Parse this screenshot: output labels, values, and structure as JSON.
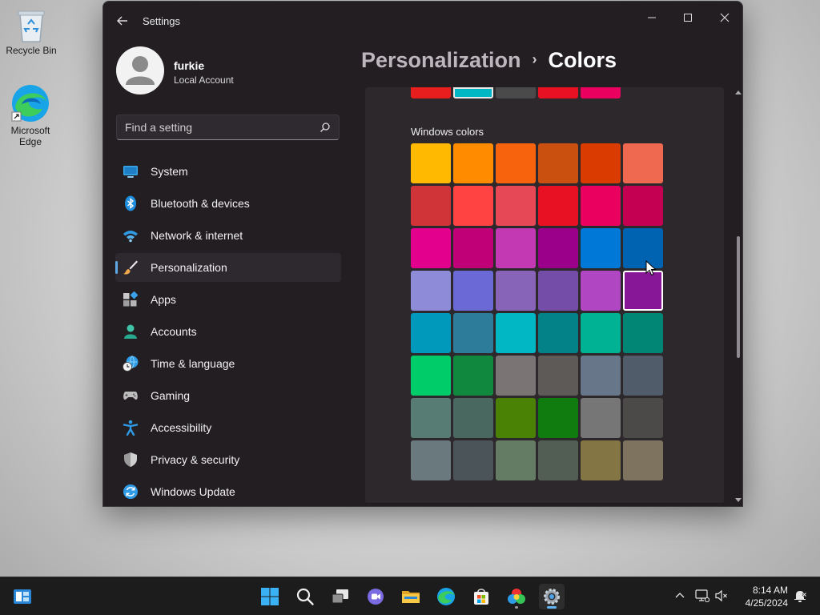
{
  "desktop": {
    "icons": [
      {
        "label": "Recycle Bin"
      },
      {
        "label": "Microsoft Edge"
      }
    ]
  },
  "window": {
    "title": "Settings",
    "user": {
      "name": "furkie",
      "account_type": "Local Account"
    },
    "search": {
      "placeholder": "Find a setting"
    },
    "nav": [
      {
        "label": "System",
        "icon": "monitor-icon"
      },
      {
        "label": "Bluetooth & devices",
        "icon": "bluetooth-icon"
      },
      {
        "label": "Network & internet",
        "icon": "wifi-icon"
      },
      {
        "label": "Personalization",
        "icon": "brush-icon",
        "active": true
      },
      {
        "label": "Apps",
        "icon": "apps-icon"
      },
      {
        "label": "Accounts",
        "icon": "person-icon"
      },
      {
        "label": "Time & language",
        "icon": "clock-globe-icon"
      },
      {
        "label": "Gaming",
        "icon": "gamepad-icon"
      },
      {
        "label": "Accessibility",
        "icon": "accessibility-icon"
      },
      {
        "label": "Privacy & security",
        "icon": "shield-icon"
      },
      {
        "label": "Windows Update",
        "icon": "update-icon"
      }
    ],
    "breadcrumb": {
      "parent": "Personalization",
      "current": "Colors"
    },
    "recent_colors": [
      "#e81e1e",
      "#00b7c3",
      "#4a4a4a",
      "#e81123",
      "#ea005e"
    ],
    "windows_colors": {
      "title": "Windows colors",
      "selected": "#881798",
      "colors": [
        "#ffb900",
        "#ff8c00",
        "#f7630c",
        "#ca5010",
        "#da3b01",
        "#ef6950",
        "#d13438",
        "#ff4343",
        "#e74856",
        "#e81123",
        "#ea005e",
        "#c30052",
        "#e3008c",
        "#bf0077",
        "#c239b3",
        "#9a0089",
        "#0078d7",
        "#0063b1",
        "#8e8cd8",
        "#6b69d6",
        "#8764b8",
        "#744da9",
        "#b146c2",
        "#881798",
        "#0099bc",
        "#2d7d9a",
        "#00b7c3",
        "#038387",
        "#00b294",
        "#018574",
        "#00cc6a",
        "#10893e",
        "#7a7574",
        "#5d5a58",
        "#68768a",
        "#515c6b",
        "#567c73",
        "#486860",
        "#498205",
        "#107c10",
        "#767676",
        "#4c4a48",
        "#69797e",
        "#4a5459",
        "#647c64",
        "#525e54",
        "#847545",
        "#7e735f"
      ]
    }
  },
  "taskbar": {
    "time": "8:14 AM",
    "date": "4/25/2024"
  },
  "colors": {
    "accent": "#5fa8e6",
    "window_bg": "#221e22",
    "card_bg": "#2c282c"
  }
}
